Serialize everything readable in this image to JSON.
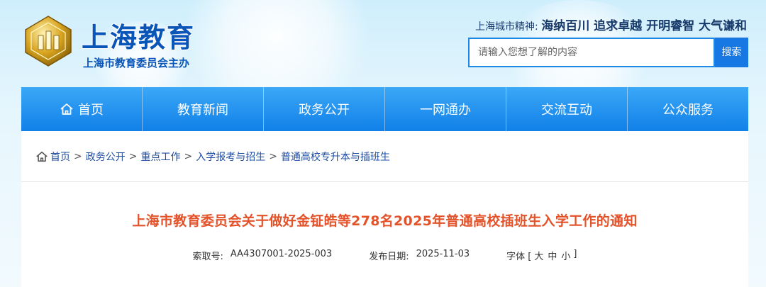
{
  "header": {
    "site_name": "上海教育",
    "site_sub": "上海市教育委员会主办",
    "slogan_label": "上海城市精神:",
    "slogan_text": "海纳百川 追求卓越 开明睿智 大气谦和",
    "search_placeholder": "请输入您想了解的内容",
    "search_button": "搜索"
  },
  "nav": {
    "items": [
      {
        "label": "首页",
        "icon": "home-icon"
      },
      {
        "label": "教育新闻"
      },
      {
        "label": "政务公开"
      },
      {
        "label": "一网通办"
      },
      {
        "label": "交流互动"
      },
      {
        "label": "公众服务"
      }
    ]
  },
  "breadcrumb": {
    "items": [
      "首页",
      "政务公开",
      "重点工作",
      "入学报考与招生",
      "普通高校专升本与插班生"
    ],
    "separator": ">"
  },
  "article": {
    "title": "上海市教育委员会关于做好金钲皓等278名2025年普通高校插班生入学工作的通知",
    "index_label": "索取号:",
    "index_value": "AA4307001-2025-003",
    "date_label": "发布日期:",
    "date_value": "2025-11-03",
    "font_label": "字体 [",
    "font_large": "大",
    "font_medium": "中",
    "font_small": "小",
    "font_end": "]"
  },
  "colors": {
    "nav_blue": "#1180e8",
    "brand_blue": "#0a55b8",
    "title_orange": "#e4522a",
    "link_blue": "#1f4ea3"
  }
}
